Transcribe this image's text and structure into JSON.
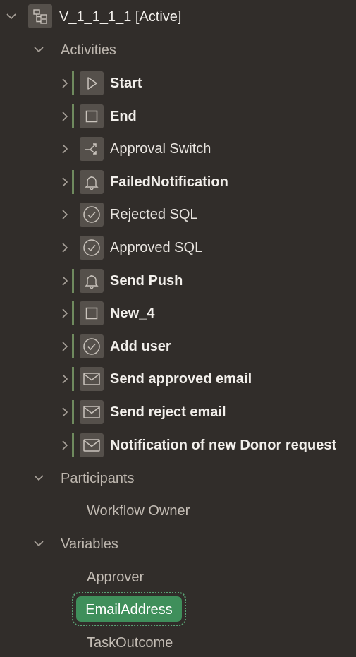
{
  "root": {
    "label": "V_1_1_1_1 [Active]",
    "icon": "hierarchy-icon"
  },
  "activities": {
    "label": "Activities",
    "items": [
      {
        "label": "Start",
        "icon": "play-icon",
        "bold": true,
        "bar": true
      },
      {
        "label": "End",
        "icon": "square-icon",
        "bold": true,
        "bar": true
      },
      {
        "label": "Approval Switch",
        "icon": "switch-icon",
        "bold": false,
        "bar": false
      },
      {
        "label": "FailedNotification",
        "icon": "bell-icon",
        "bold": true,
        "bar": true
      },
      {
        "label": "Rejected SQL",
        "icon": "check-circle-icon",
        "bold": false,
        "bar": false
      },
      {
        "label": "Approved SQL",
        "icon": "check-circle-icon",
        "bold": false,
        "bar": false
      },
      {
        "label": "Send Push",
        "icon": "bell-icon",
        "bold": true,
        "bar": true
      },
      {
        "label": "New_4",
        "icon": "square-icon",
        "bold": true,
        "bar": true
      },
      {
        "label": "Add user",
        "icon": "check-circle-icon",
        "bold": true,
        "bar": true
      },
      {
        "label": "Send approved email",
        "icon": "envelope-icon",
        "bold": true,
        "bar": true
      },
      {
        "label": "Send reject email",
        "icon": "envelope-icon",
        "bold": true,
        "bar": true
      },
      {
        "label": "Notification of new Donor request",
        "icon": "envelope-icon",
        "bold": true,
        "bar": true
      }
    ]
  },
  "participants": {
    "label": "Participants",
    "items": [
      {
        "label": "Workflow Owner"
      }
    ]
  },
  "variables": {
    "label": "Variables",
    "items": [
      {
        "label": "Approver"
      },
      {
        "label": "EmailAddress",
        "selected": true
      },
      {
        "label": "TaskOutcome"
      }
    ]
  },
  "colors": {
    "background": "#312d2a",
    "icon_tile": "#55504b",
    "modified_bar": "#6f8a5e",
    "selection": "#3f8f5b"
  }
}
